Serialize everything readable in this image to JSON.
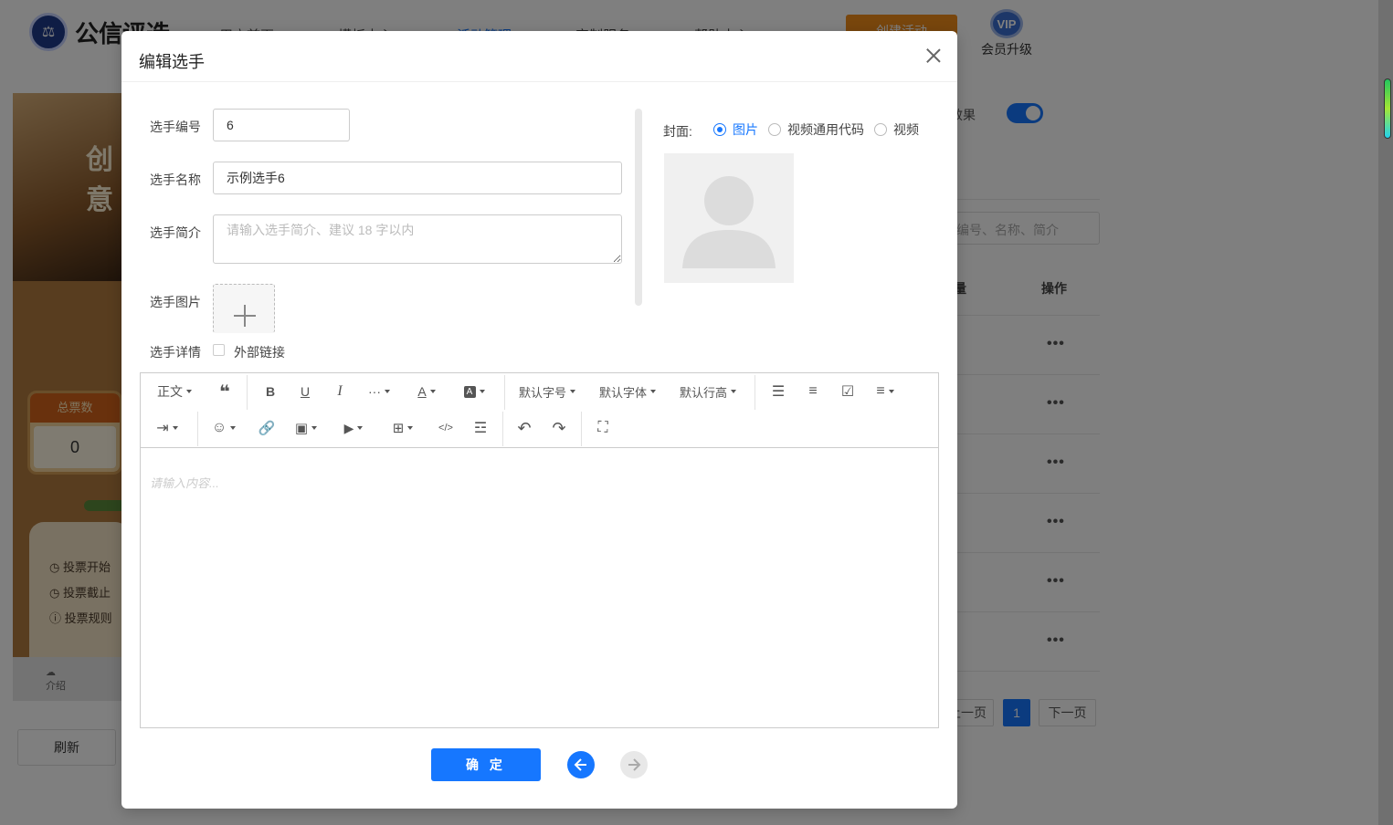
{
  "background": {
    "logo_text": "公信评选",
    "nav": [
      "用户首页",
      "模板中心",
      "活动管理",
      "定制服务",
      "帮助中心"
    ],
    "create_label": "创建活动",
    "vip_badge": "VIP",
    "vip_label": "会员升级",
    "phone": {
      "title": "创意",
      "total_votes_label": "总票数",
      "total_votes_value": "0",
      "info": [
        "投票开始",
        "投票截止",
        "投票规则"
      ],
      "tab_label": "介绍"
    },
    "refresh_label": "刷新",
    "effect_label": "效果",
    "search_placeholder": "编号、名称、简介",
    "table_headers": [
      "量",
      "操作"
    ],
    "row_actions": [
      "•••",
      "•••",
      "•••",
      "•••",
      "•••",
      "•••"
    ],
    "pagination": {
      "prev": "上一页",
      "current": "1",
      "next": "下一页"
    }
  },
  "modal": {
    "title": "编辑选手",
    "fields": {
      "number_label": "选手编号",
      "number_value": "6",
      "name_label": "选手名称",
      "name_value": "示例选手6",
      "intro_label": "选手简介",
      "intro_placeholder": "请输入选手简介、建议 18 字以内",
      "image_label": "选手图片",
      "detail_label": "选手详情",
      "external_link_label": "外部链接"
    },
    "cover": {
      "label": "封面:",
      "options": [
        "图片",
        "视频通用代码",
        "视频"
      ],
      "selected": "图片"
    },
    "editor": {
      "paragraph": "正文",
      "font_size": "默认字号",
      "font_family": "默认字体",
      "line_height": "默认行高",
      "placeholder": "请输入内容..."
    },
    "confirm_label": "确 定"
  }
}
